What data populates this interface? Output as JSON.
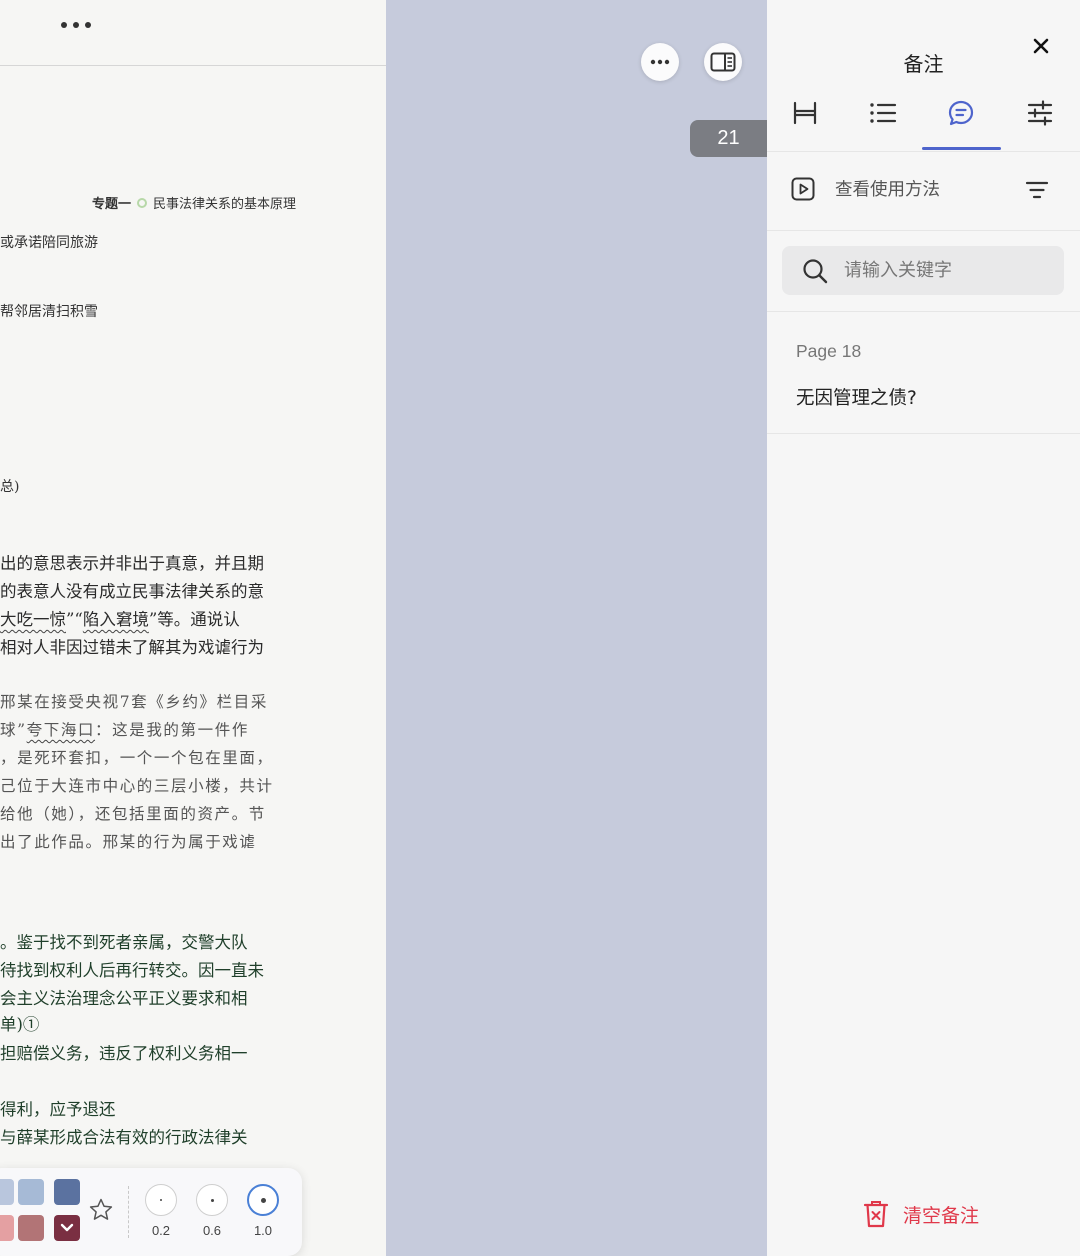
{
  "document": {
    "header": {
      "section": "专题一",
      "title": "民事法律关系的基本原理"
    },
    "lines": [
      "或承诺陪同旅游",
      "帮邻居清扫积雪",
      "总)",
      "出的意思表示并非出于真意，并且期",
      "的表意人没有成立民事法律关系的意",
      "大吃一惊",
      "”“",
      "陷入窘境",
      "”等。通说认",
      "相对人非因过错未了解其为戏谑行为",
      "邢某在接受央视7套《乡约》栏目采",
      "球”",
      "夸下海口",
      "：这是我的第一件作",
      "，是死环套扣，一个一个包在里面，",
      "己位于大连市中心的三层小楼，共计",
      "给他（她），还包括里面的资产。节",
      "出了此作品。邢某的行为属于戏谑",
      "。鉴于找不到死者亲属，交警大队",
      "待找到权利人后再行转交。因一直未",
      "会主义法治理念公平正义要求和相",
      "单)①",
      "担赔偿义务，违反了权利义务相一",
      "得利，应予退还",
      "与薛某形成合法有效的行政法律关"
    ]
  },
  "toolbar": {
    "stroke_options": [
      {
        "label": "0.2"
      },
      {
        "label": "0.6"
      },
      {
        "label": "1.0"
      }
    ],
    "swatch_colors": [
      "#a6bad6",
      "#5b72a0",
      "#e4a0a2",
      "#b27476",
      "#7a2f42"
    ],
    "selected_stroke": "1.0"
  },
  "gutter": {
    "page_number": "21"
  },
  "panel": {
    "title": "备注",
    "tabs": [
      "bookmark-icon",
      "toc-list-icon",
      "notes-icon",
      "settings-sliders-icon"
    ],
    "active_tab": "notes-icon",
    "howto_label": "查看使用方法",
    "search_placeholder": "请输入关键字",
    "notes": [
      {
        "page": "Page 18",
        "text": "无因管理之债?"
      }
    ],
    "clear_label": "清空备注",
    "accent_color": "#4e64cc",
    "danger_color": "#e0384a"
  }
}
